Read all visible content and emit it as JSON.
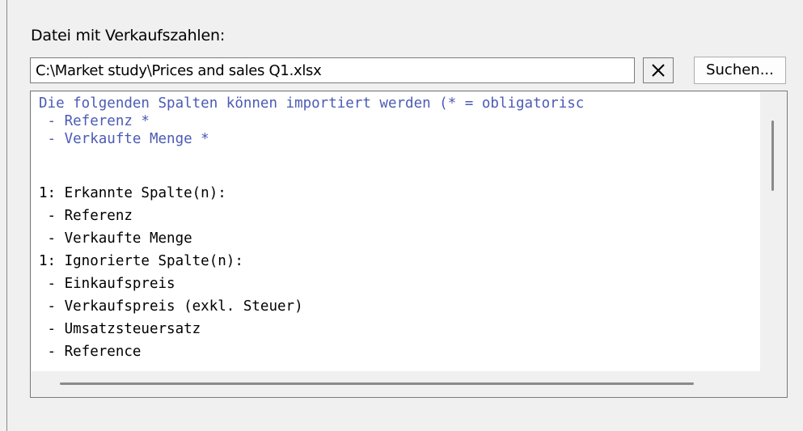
{
  "form": {
    "file_label": "Datei mit Verkaufszahlen:",
    "file_path": "C:\\Market study\\Prices and sales Q1.xlsx",
    "clear_icon": "close-icon",
    "browse_label": "Suchen..."
  },
  "log": {
    "lines": [
      {
        "text": "Die folgenden Spalten können importiert werden (* = obligatorisc",
        "style": "hint"
      },
      {
        "text": " - Referenz *",
        "style": "hint"
      },
      {
        "text": " - Verkaufte Menge *",
        "style": "hint"
      },
      {
        "text": "",
        "style": "result"
      },
      {
        "text": "1: Erkannte Spalte(n):",
        "style": "result"
      },
      {
        "text": " - Referenz",
        "style": "result"
      },
      {
        "text": " - Verkaufte Menge",
        "style": "result"
      },
      {
        "text": "1: Ignorierte Spalte(n):",
        "style": "result"
      },
      {
        "text": " - Einkaufspreis",
        "style": "result"
      },
      {
        "text": " - Verkaufspreis (exkl. Steuer)",
        "style": "result"
      },
      {
        "text": " - Umsatzsteuersatz",
        "style": "result"
      },
      {
        "text": " - Reference",
        "style": "result"
      }
    ]
  },
  "colors": {
    "hint_text": "#4b5bb5",
    "result_text": "#000000",
    "panel_background": "#f0f0f0"
  }
}
